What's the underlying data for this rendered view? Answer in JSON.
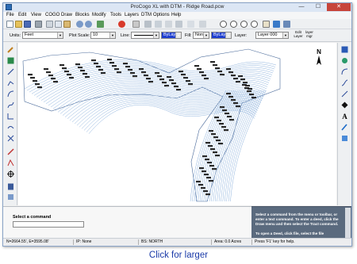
{
  "window": {
    "title": "ProCogo XL with DTM - Ridge Road.pcw"
  },
  "window_controls": {
    "minimize": "—",
    "maximize": "☐",
    "close": "✕"
  },
  "menu": [
    "File",
    "Edit",
    "View",
    "COGO",
    "Draw",
    "Blocks",
    "Modify",
    "Tools",
    "Layers",
    "DTM",
    "Options",
    "Help"
  ],
  "props": {
    "units_label": "Units:",
    "units_value": "Feet",
    "plot_scale_label": "Plot Scale: 1\"=",
    "plot_scale_value": "10",
    "line_label": "Line:",
    "line_layer": "ByLayer",
    "fill_label": "Fill:",
    "fill_value": "None",
    "fill_layer": "ByLayer",
    "layer_label": "Layer:",
    "layer_value": "Layer 000",
    "edit_layer": "Edit Layer",
    "layer_mgr": "layer mgr"
  },
  "command": {
    "label": "Select a command"
  },
  "help": {
    "text": "Select a command from the menu or toolbar, or enter a text command. To enter a deed, click the Draw menu and then select the Tract command.",
    "more": "To open a Deed, click file, select the file"
  },
  "status": {
    "coords": "N=2664.55', E=3595.08'",
    "ip": "IP: None",
    "bs": "BS: NORTH",
    "area": "Area: 0.0 Acres",
    "help": "Press 'F1' key for help."
  },
  "caption": "Click for larger",
  "north_label": "N",
  "colors": {
    "accent": "#1f3fd0",
    "close": "#c7453b",
    "contour": "#7fa8d8",
    "caption": "#1a3aa8",
    "helpbg": "#5a6a7e"
  },
  "icons": {
    "toolbar": [
      "new-icon",
      "open-icon",
      "save-icon",
      "print-icon",
      "cut-icon",
      "copy-icon",
      "paste-icon",
      "undo-icon",
      "redo-icon",
      "draw-icon",
      "delete-icon",
      "zoom-in-icon",
      "zoom-out-icon",
      "pan-icon"
    ],
    "left": [
      "pencil-icon",
      "node-icon",
      "line-icon",
      "polyline-icon",
      "arc-icon",
      "curve-icon",
      "spiral-icon",
      "offset-icon",
      "point-icon",
      "target-icon",
      "calculator-icon"
    ],
    "right": [
      "layer-icon",
      "refresh-icon",
      "arc-draw-icon",
      "curve-draw-icon",
      "diamond-icon",
      "text-icon",
      "paint-icon",
      "extent-icon"
    ]
  }
}
